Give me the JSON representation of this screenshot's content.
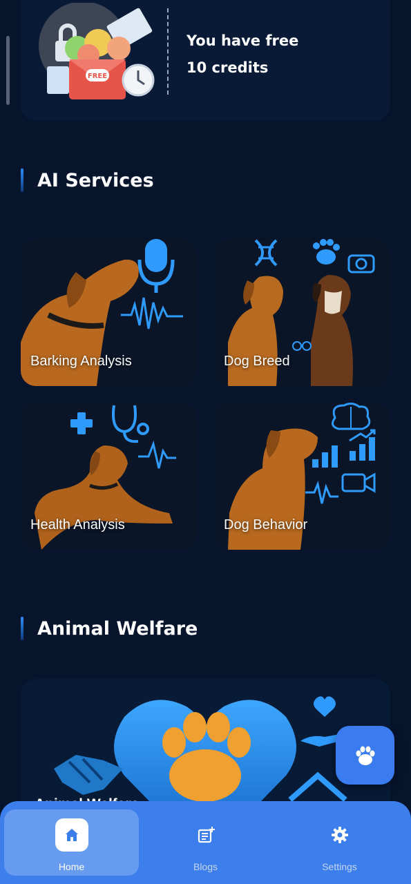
{
  "credits": {
    "line1": "You have free",
    "line2": "10 credits",
    "badge": "FREE"
  },
  "sections": {
    "ai_services": "AI Services",
    "animal_welfare": "Animal Welfare"
  },
  "services": [
    {
      "label": "Barking Analysis",
      "icon": "microphone-icon"
    },
    {
      "label": "Dog Breed",
      "icon": "dna-icon"
    },
    {
      "label": "Health Analysis",
      "icon": "stethoscope-icon"
    },
    {
      "label": "Dog Behavior",
      "icon": "brain-icon"
    }
  ],
  "welfare": {
    "label": "Animal Welfare"
  },
  "fab": {
    "icon": "paw-icon"
  },
  "nav": [
    {
      "label": "Home",
      "icon": "home-icon",
      "active": true
    },
    {
      "label": "Blogs",
      "icon": "blog-icon",
      "active": false
    },
    {
      "label": "Settings",
      "icon": "gear-icon",
      "active": false
    }
  ],
  "colors": {
    "background": "#06142c",
    "accent": "#3c7fec",
    "glow": "#2f9bff"
  }
}
